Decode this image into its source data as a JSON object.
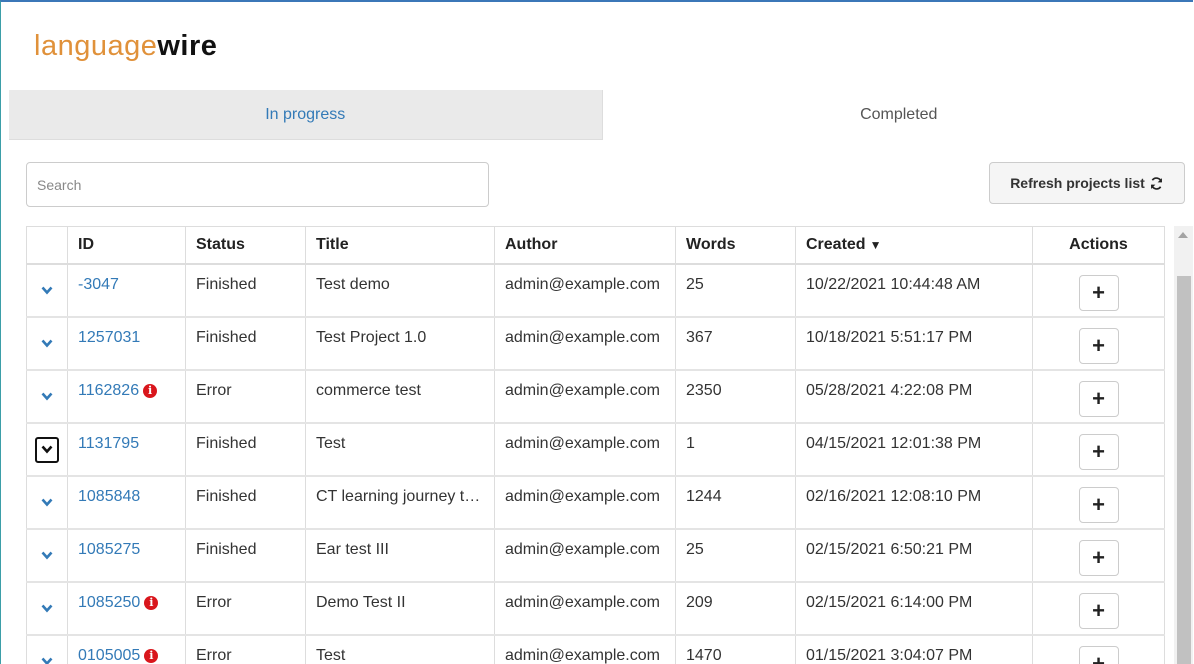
{
  "brand": {
    "part1": "language",
    "part2": "wire"
  },
  "tabs": [
    {
      "label": "In progress",
      "active": false
    },
    {
      "label": "Completed",
      "active": true
    }
  ],
  "search": {
    "placeholder": "Search"
  },
  "refresh": {
    "label": "Refresh projects list",
    "icon": "refresh-icon"
  },
  "table": {
    "headers": {
      "id": "ID",
      "status": "Status",
      "title": "Title",
      "author": "Author",
      "words": "Words",
      "created": "Created",
      "actions": "Actions"
    },
    "sort_icon": "▼",
    "action_label": "+",
    "error_icon": "i",
    "rows": [
      {
        "id": "-3047",
        "error": false,
        "status": "Finished",
        "title": "Test demo",
        "author": "admin@example.com",
        "words": "25",
        "created": "10/22/2021 10:44:48 AM"
      },
      {
        "id": "1257031",
        "error": false,
        "status": "Finished",
        "title": "Test Project 1.0",
        "author": "admin@example.com",
        "words": "367",
        "created": "10/18/2021 5:51:17 PM"
      },
      {
        "id": "1162826",
        "error": true,
        "status": "Error",
        "title": "commerce test",
        "author": "admin@example.com",
        "words": "2350",
        "created": "05/28/2021 4:22:08 PM"
      },
      {
        "id": "1131795",
        "error": false,
        "status": "Finished",
        "title": "Test",
        "author": "admin@example.com",
        "words": "1",
        "created": "04/15/2021 12:01:38 PM",
        "focused": true
      },
      {
        "id": "1085848",
        "error": false,
        "status": "Finished",
        "title": "CT learning journey test",
        "author": "admin@example.com",
        "words": "1244",
        "created": "02/16/2021 12:08:10 PM"
      },
      {
        "id": "1085275",
        "error": false,
        "status": "Finished",
        "title": "Ear test III",
        "author": "admin@example.com",
        "words": "25",
        "created": "02/15/2021 6:50:21 PM"
      },
      {
        "id": "1085250",
        "error": true,
        "status": "Error",
        "title": "Demo Test II",
        "author": "admin@example.com",
        "words": "209",
        "created": "02/15/2021 6:14:00 PM"
      },
      {
        "id": "0105005",
        "error": true,
        "status": "Error",
        "title": "Test",
        "author": "admin@example.com",
        "words": "1470",
        "created": "01/15/2021 3:04:07 PM"
      }
    ]
  },
  "colors": {
    "brand_orange": "#e0913a",
    "link_blue": "#337ab7",
    "error_red": "#d9161c"
  }
}
